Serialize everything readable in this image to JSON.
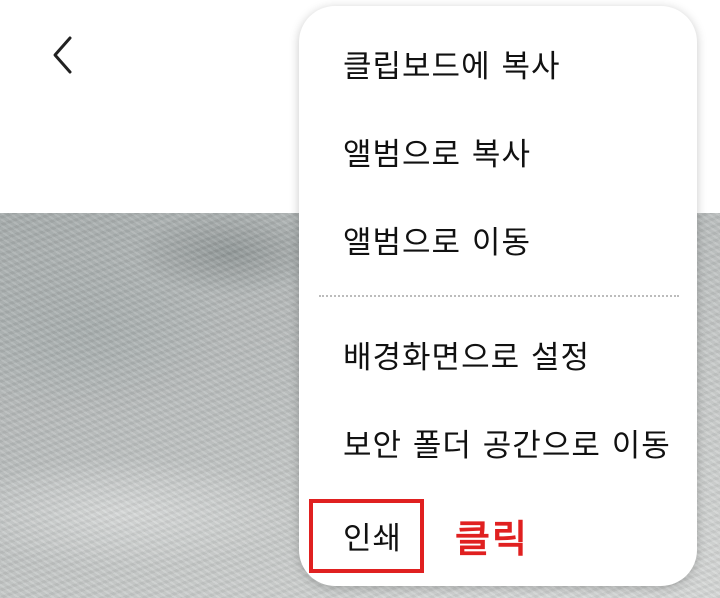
{
  "header": {
    "back_icon": "chevron-left-icon"
  },
  "menu": {
    "items": [
      {
        "label": "클립보드에 복사"
      },
      {
        "label": "앨범으로 복사"
      },
      {
        "label": "앨범으로 이동"
      },
      {
        "label": "배경화면으로 설정"
      },
      {
        "label": "보안 폴더 공간으로 이동"
      },
      {
        "label": "인쇄"
      }
    ]
  },
  "annotation": {
    "label": "클릭",
    "color": "#e02020"
  }
}
